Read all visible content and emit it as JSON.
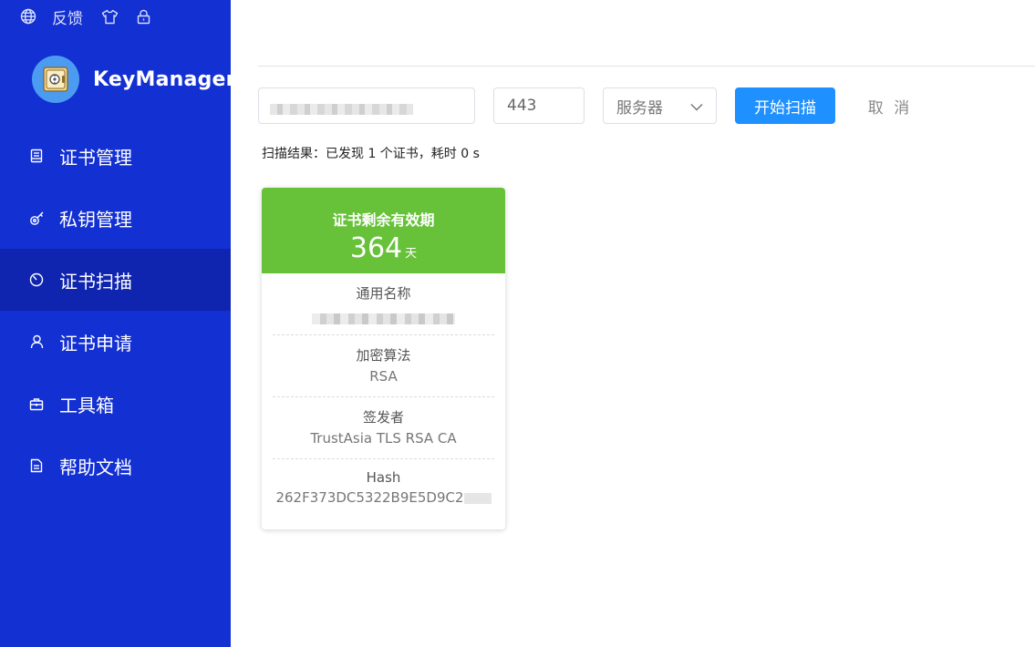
{
  "topbar": {
    "items": [
      {
        "icon": "globe-icon"
      },
      {
        "label": "反馈"
      },
      {
        "icon": "shirt-icon"
      },
      {
        "icon": "lock-icon"
      }
    ]
  },
  "brand": {
    "name": "KeyManager",
    "logo_icon": "safe-icon"
  },
  "nav": {
    "items": [
      {
        "label": "证书管理",
        "icon": "certificate-icon",
        "active": false
      },
      {
        "label": "私钥管理",
        "icon": "key-icon",
        "active": false
      },
      {
        "label": "证书扫描",
        "icon": "scan-icon",
        "active": true
      },
      {
        "label": "证书申请",
        "icon": "user-icon",
        "active": false
      },
      {
        "label": "工具箱",
        "icon": "toolbox-icon",
        "active": false
      },
      {
        "label": "帮助文档",
        "icon": "document-icon",
        "active": false
      }
    ]
  },
  "scan_form": {
    "host_value": "",
    "port_value": "443",
    "type_selected": "服务器",
    "scan_button": "开始扫描",
    "cancel_button": "取 消"
  },
  "result": {
    "text": "扫描结果：已发现 1 个证书，耗时 0 s"
  },
  "certificate": {
    "validity_title": "证书剩余有效期",
    "days_left": "364",
    "days_unit": "天",
    "fields": [
      {
        "label": "通用名称",
        "value": ""
      },
      {
        "label": "加密算法",
        "value": "RSA"
      },
      {
        "label": "签发者",
        "value": "TrustAsia TLS RSA CA"
      },
      {
        "label": "Hash",
        "value": "262F373DC5322B9E5D9C2"
      }
    ]
  },
  "colors": {
    "sidebar": "#1330d2",
    "sidebar_active": "#0f25b0",
    "primary_button": "#1e90ff",
    "card_header": "#67c23a"
  }
}
